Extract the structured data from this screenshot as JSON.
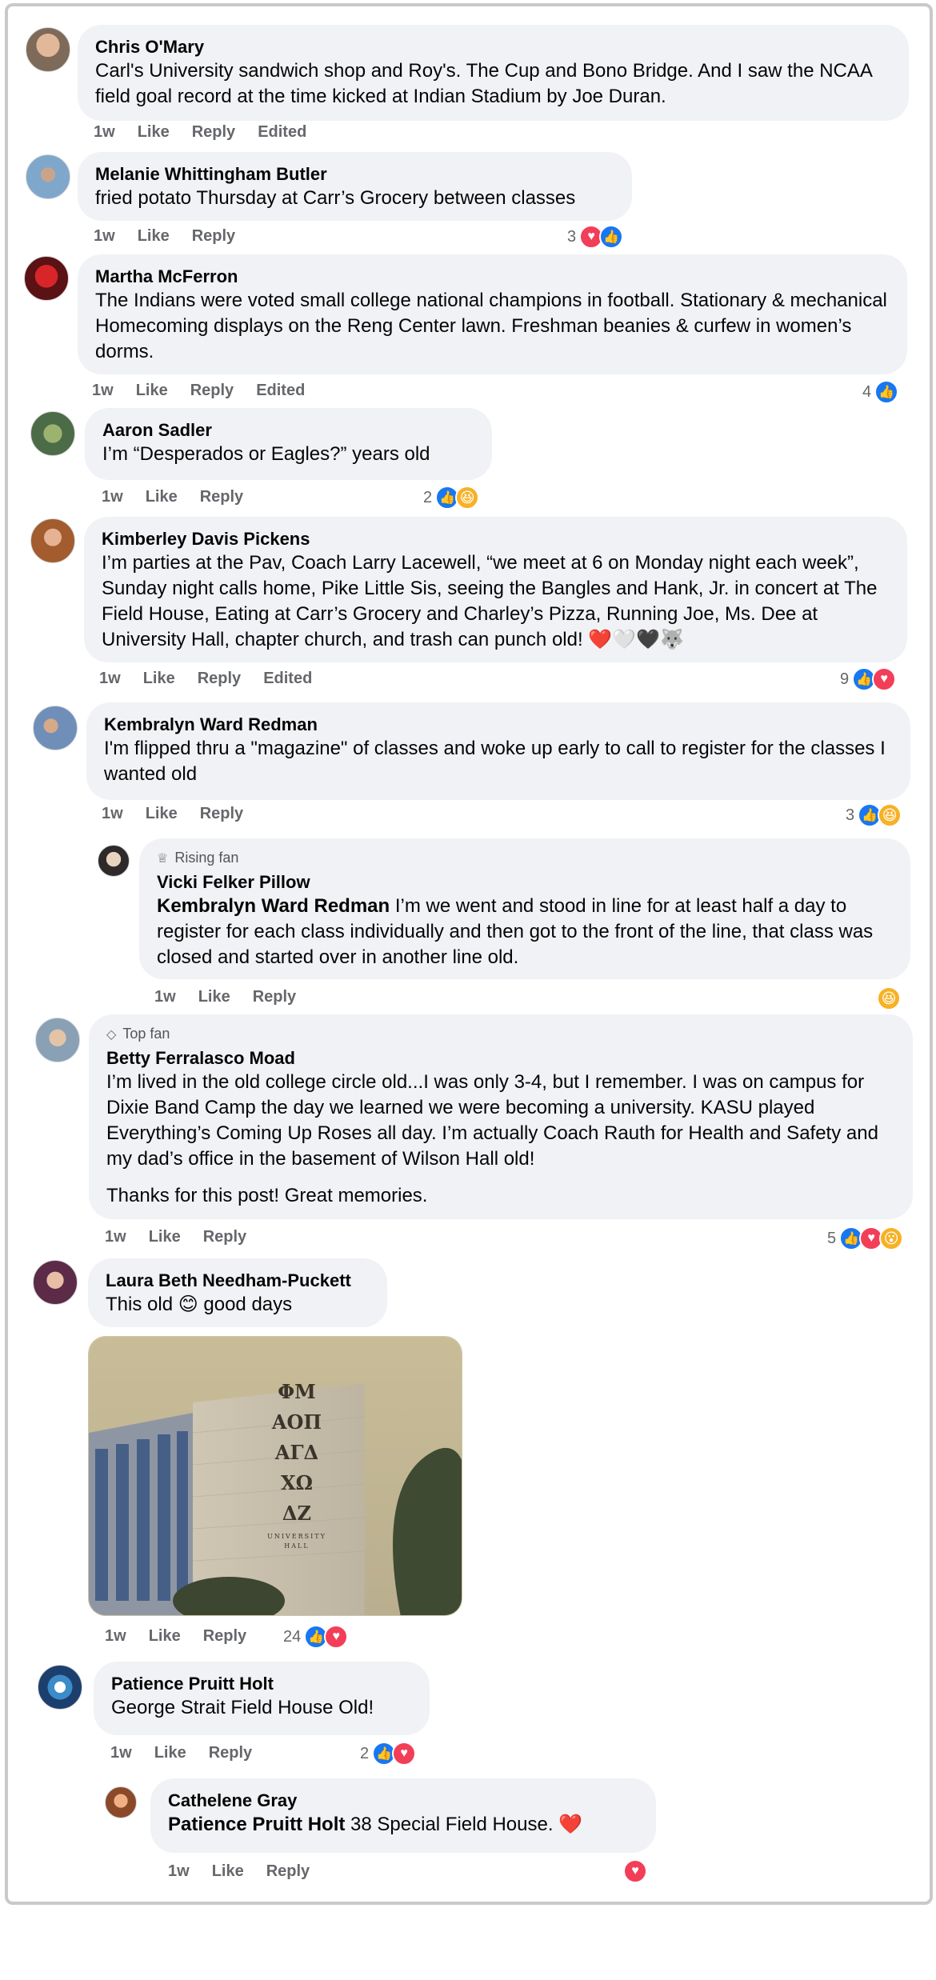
{
  "comments": [
    {
      "author": "Chris O'Mary",
      "text": "Carl's University sandwich shop and Roy's. The Cup and Bono Bridge. And I saw the NCAA field goal record at the time kicked at Indian Stadium by Joe Duran.",
      "time": "1w",
      "like": "Like",
      "reply": "Reply",
      "edited": "Edited"
    },
    {
      "author": "Melanie Whittingham Butler",
      "text": "fried potato Thursday at Carr’s Grocery between classes",
      "time": "1w",
      "like": "Like",
      "reply": "Reply",
      "reaction_count": "3",
      "reactions": [
        "love",
        "like"
      ]
    },
    {
      "author": "Martha McFerron",
      "text": "The Indians were voted small college national champions in football. Stationary & mechanical Homecoming displays on the Reng Center lawn. Freshman beanies & curfew in women’s dorms.",
      "time": "1w",
      "like": "Like",
      "reply": "Reply",
      "edited": "Edited",
      "reaction_count": "4",
      "reactions": [
        "like"
      ]
    },
    {
      "author": "Aaron Sadler",
      "text": "I’m “Desperados or Eagles?” years old",
      "time": "1w",
      "like": "Like",
      "reply": "Reply",
      "reaction_count": "2",
      "reactions": [
        "like",
        "haha"
      ]
    },
    {
      "author": "Kimberley Davis Pickens",
      "text": "I’m parties at the Pav, Coach Larry Lacewell, “we meet at 6 on Monday night each week”, Sunday night calls home, Pike Little Sis, seeing the Bangles and Hank, Jr. in concert at The Field House, Eating at Carr’s Grocery and Charley’s Pizza, Running Joe, Ms. Dee at University Hall, chapter church, and trash can punch old! ❤️🤍🖤🐺",
      "time": "1w",
      "like": "Like",
      "reply": "Reply",
      "edited": "Edited",
      "reaction_count": "9",
      "reactions": [
        "like",
        "love"
      ]
    },
    {
      "author": "Kembralyn Ward Redman",
      "text": "I'm flipped thru a \"magazine\" of classes and woke up early to call to register for the classes I wanted old",
      "time": "1w",
      "like": "Like",
      "reply": "Reply",
      "reaction_count": "3",
      "reactions": [
        "like",
        "haha"
      ]
    },
    {
      "badge": "Rising fan",
      "author": "Vicki Felker Pillow",
      "mention": "Kembralyn Ward Redman",
      "text": " I’m we went and stood in line for at least half a day to register for each class individually and then got to the front of the line, that class was closed and started over in another line old.",
      "time": "1w",
      "like": "Like",
      "reply": "Reply",
      "reactions": [
        "haha"
      ]
    },
    {
      "badge": "Top fan",
      "author": "Betty Ferralasco Moad",
      "text": "I’m lived in the old college circle old...I was only 3-4, but I remember. I was on campus for Dixie Band Camp the day we learned we were becoming a university. KASU played Everything’s Coming Up Roses all day. I’m actually Coach Rauth for Health and Safety and my dad’s office in the basement of Wilson Hall old!",
      "text2": "Thanks for this post! Great memories.",
      "time": "1w",
      "like": "Like",
      "reply": "Reply",
      "reaction_count": "5",
      "reactions": [
        "like",
        "love",
        "wow"
      ]
    },
    {
      "author": "Laura Beth Needham-Puckett",
      "text": "This old 😊 good days",
      "time": "1w",
      "like": "Like",
      "reply": "Reply",
      "reaction_count": "24",
      "reactions": [
        "like",
        "love"
      ],
      "photo_letters": [
        "ΦΜ",
        "ΑΟΠ",
        "ΑΓΔ",
        "ΧΩ",
        "ΔΖ"
      ],
      "photo_caption": "UNIVERSITY HALL"
    },
    {
      "author": "Patience Pruitt Holt",
      "text": "George Strait Field House Old!",
      "time": "1w",
      "like": "Like",
      "reply": "Reply",
      "reaction_count": "2",
      "reactions": [
        "like",
        "love"
      ]
    },
    {
      "author": "Cathelene Gray",
      "mention": "Patience Pruitt Holt",
      "text": " 38 Special Field House. ❤️",
      "time": "1w",
      "like": "Like",
      "reply": "Reply",
      "reactions": [
        "love"
      ]
    }
  ],
  "colors": {
    "bubble": "#f0f2f5",
    "meta": "#65676b",
    "like": "#1877f2",
    "love": "#f33e58",
    "haha": "#f7b125"
  }
}
